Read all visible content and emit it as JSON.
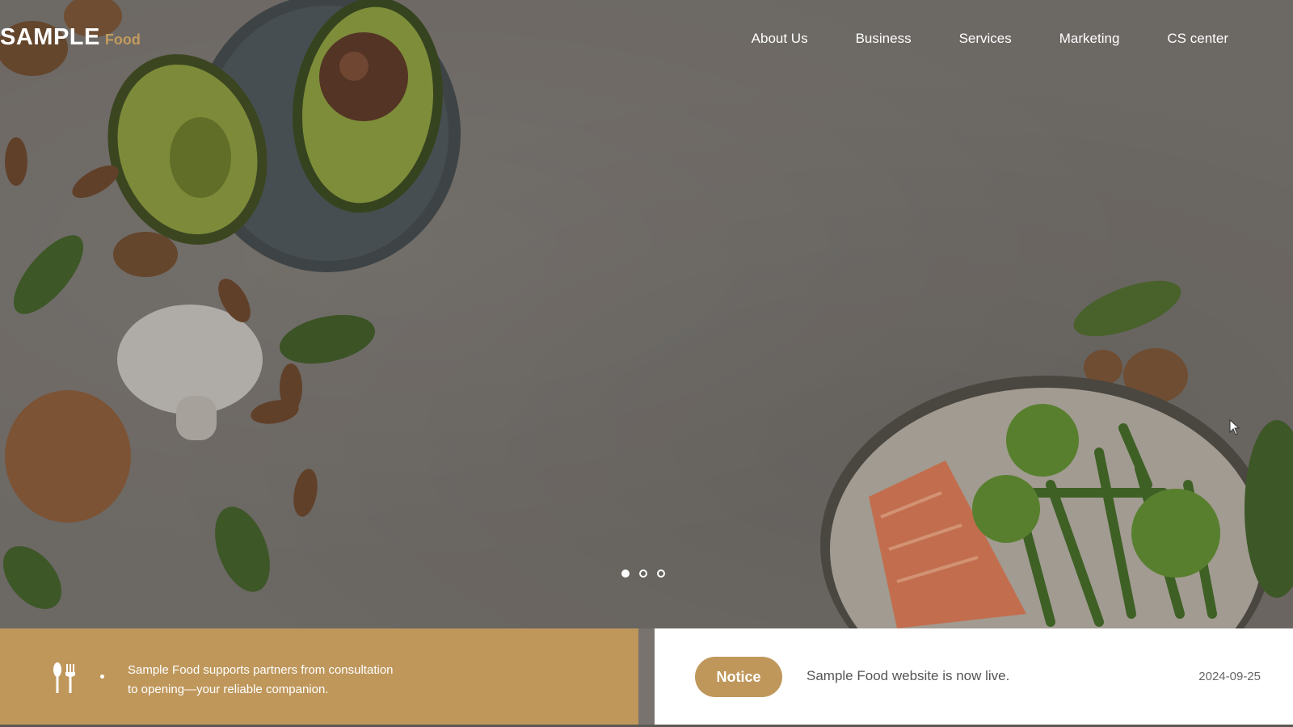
{
  "header": {
    "logo_main": "SAMPLE",
    "logo_sub": "Food",
    "nav": [
      {
        "label": "About Us"
      },
      {
        "label": "Business"
      },
      {
        "label": "Services"
      },
      {
        "label": "Marketing"
      },
      {
        "label": "CS center"
      }
    ]
  },
  "slider": {
    "slide_count": 3,
    "active_index": 0
  },
  "intro": {
    "icon": "utensils-icon",
    "line1": "Sample Food supports partners from consultation",
    "line2": "to opening—your reliable companion."
  },
  "notice": {
    "badge": "Notice",
    "text": "Sample Food website is now live.",
    "date": "2024-09-25"
  },
  "colors": {
    "accent": "#bf975b",
    "hero_overlay": "#77736f",
    "white": "#ffffff"
  }
}
